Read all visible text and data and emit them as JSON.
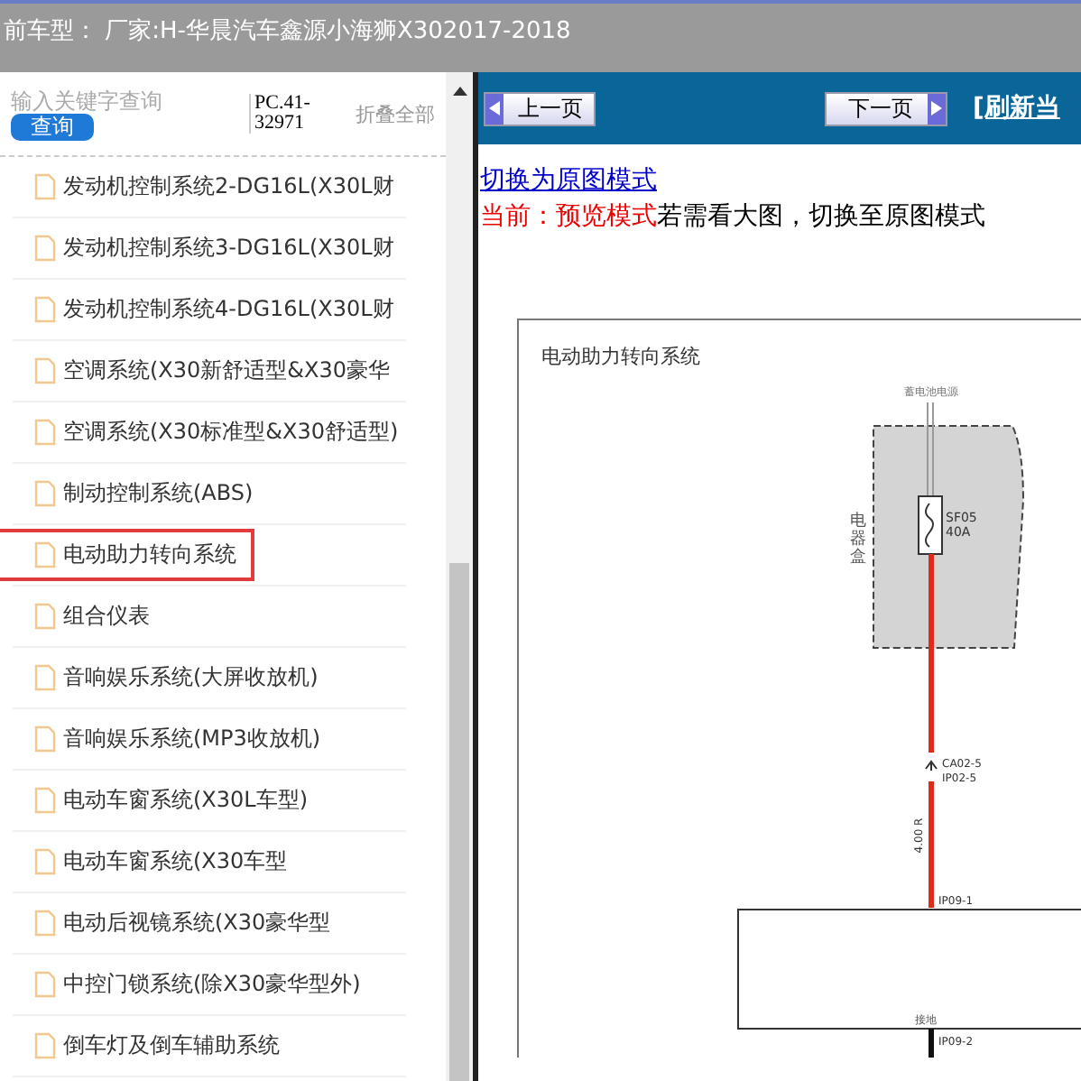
{
  "header": {
    "title": "前车型： 厂家:H-华晨汽车鑫源小海狮X302017-2018"
  },
  "search": {
    "placeholder": "输入关键字查询",
    "button": "查询",
    "code": "PC.41-32971",
    "collapse": "折叠全部"
  },
  "items": [
    {
      "label": "发动机控制系统2-DG16L(X30L财",
      "selected": false
    },
    {
      "label": "发动机控制系统3-DG16L(X30L财",
      "selected": false
    },
    {
      "label": "发动机控制系统4-DG16L(X30L财",
      "selected": false
    },
    {
      "label": "空调系统(X30新舒适型&X30豪华",
      "selected": false
    },
    {
      "label": "空调系统(X30标准型&X30舒适型)",
      "selected": false
    },
    {
      "label": "制动控制系统(ABS)",
      "selected": false
    },
    {
      "label": "电动助力转向系统",
      "selected": true
    },
    {
      "label": "组合仪表",
      "selected": false
    },
    {
      "label": "音响娱乐系统(大屏收放机)",
      "selected": false
    },
    {
      "label": "音响娱乐系统(MP3收放机)",
      "selected": false
    },
    {
      "label": "电动车窗系统(X30L车型)",
      "selected": false
    },
    {
      "label": "电动车窗系统(X30车型",
      "selected": false
    },
    {
      "label": "电动后视镜系统(X30豪华型",
      "selected": false
    },
    {
      "label": "中控门锁系统(除X30豪华型外)",
      "selected": false
    },
    {
      "label": "倒车灯及倒车辅助系统",
      "selected": false
    }
  ],
  "nav": {
    "prev": "上一页",
    "next": "下一页",
    "refresh": "[刷新当"
  },
  "mode": {
    "link": "切换为原图模式",
    "current": "当前：预览模式",
    "hint": "若需看大图，切换至原图模式"
  },
  "diagram": {
    "title": "电动助力转向系统",
    "power_label": "蓄电池电源",
    "box_label": "电器盒",
    "fuse": [
      "SF05",
      "40A"
    ],
    "connector": [
      "CA02-5",
      "IP02-5"
    ],
    "wire_label": "4.00 R",
    "pins": [
      "IP09-1",
      "IP09-2"
    ],
    "ground_label": "接地"
  }
}
